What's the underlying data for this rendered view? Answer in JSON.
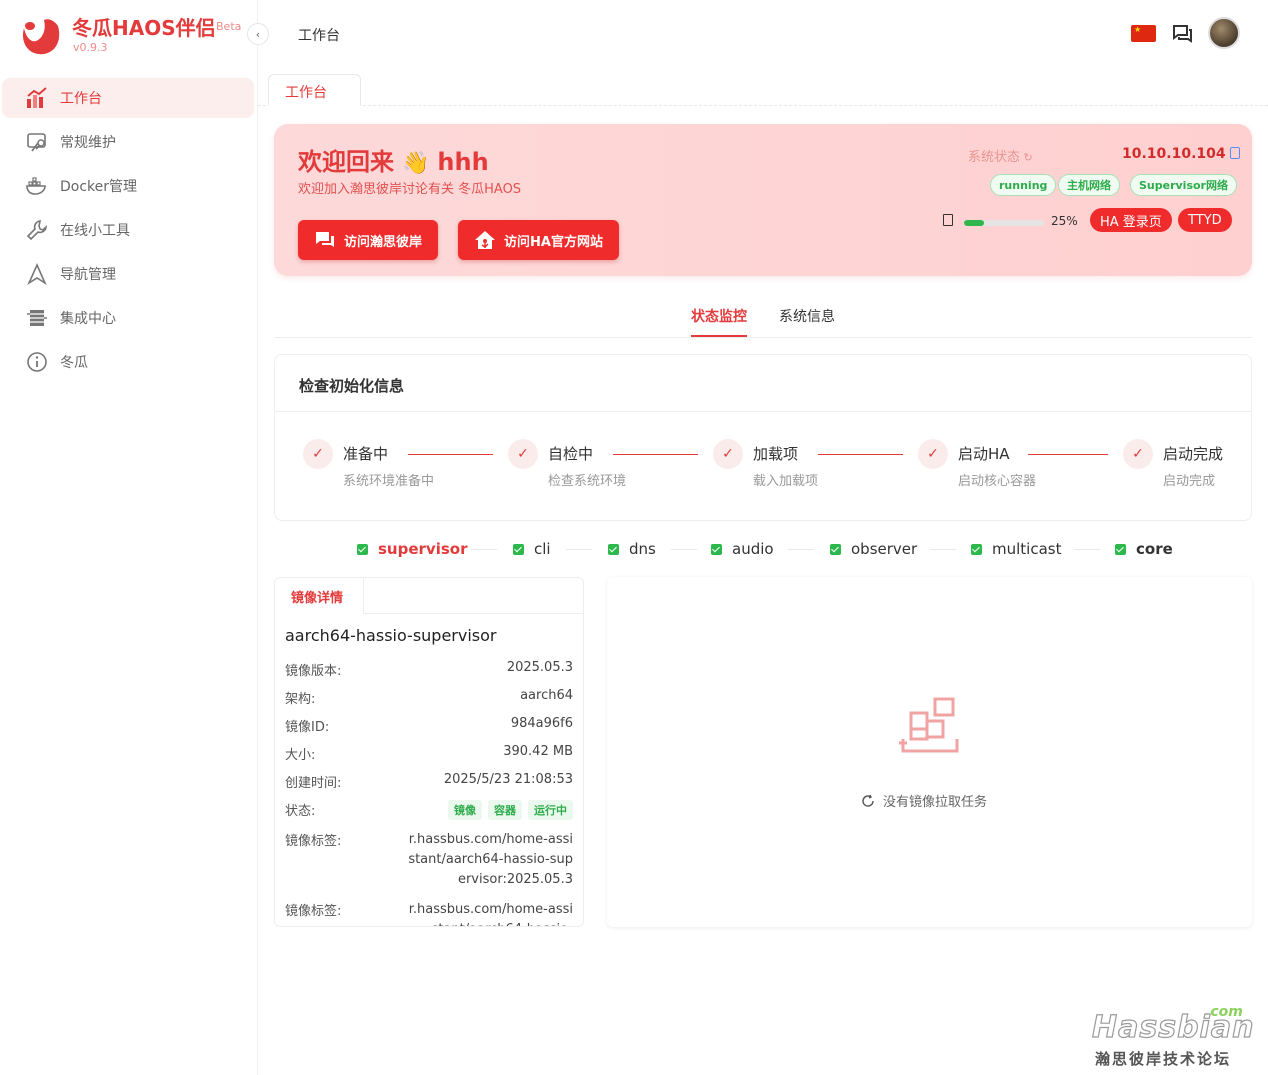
{
  "brand": {
    "title": "冬瓜HAOS伴侣",
    "beta": "Beta",
    "version": "v0.9.3"
  },
  "sidebar": {
    "items": [
      {
        "label": "工作台",
        "icon": "dashboard-icon",
        "active": true
      },
      {
        "label": "常规维护",
        "icon": "maintenance-icon"
      },
      {
        "label": "Docker管理",
        "icon": "docker-icon"
      },
      {
        "label": "在线小工具",
        "icon": "wrench-icon"
      },
      {
        "label": "导航管理",
        "icon": "navigation-icon"
      },
      {
        "label": "集成中心",
        "icon": "integration-icon"
      },
      {
        "label": "冬瓜",
        "icon": "info-icon"
      }
    ]
  },
  "header": {
    "breadcrumb": "工作台"
  },
  "tabs": {
    "page_tab": "工作台"
  },
  "welcome": {
    "title": "欢迎回来",
    "user": "hhh",
    "subtitle": "欢迎加入瀚思彼岸讨论有关 冬瓜HAOS",
    "btn_forum": "访问瀚思彼岸",
    "btn_ha": "访问HA官方网站",
    "system_status_label": "系统状态",
    "ip": "10.10.10.104",
    "pills": [
      "running",
      "主机网络",
      "Supervisor网络"
    ],
    "disk_percent_text": "25%",
    "disk_fraction": 0.25,
    "btn_ha_login": "HA 登录页",
    "btn_ttyd": "TTYD"
  },
  "segments": {
    "monitor": "状态监控",
    "sysinfo": "系统信息"
  },
  "init": {
    "title": "检查初始化信息",
    "steps": [
      {
        "title": "准备中",
        "desc": "系统环境准备中"
      },
      {
        "title": "自检中",
        "desc": "检查系统环境"
      },
      {
        "title": "加载项",
        "desc": "载入加载项"
      },
      {
        "title": "启动HA",
        "desc": "启动核心容器"
      },
      {
        "title": "启动完成",
        "desc": "启动完成"
      }
    ]
  },
  "components": [
    "supervisor",
    "cli",
    "dns",
    "audio",
    "observer",
    "multicast",
    "core"
  ],
  "detail": {
    "tab": "镜像详情",
    "name": "aarch64-hassio-supervisor",
    "rows": [
      {
        "k": "镜像版本:",
        "v": "2025.05.3"
      },
      {
        "k": "架构:",
        "v": "aarch64"
      },
      {
        "k": "镜像ID:",
        "v": "984a96f6"
      },
      {
        "k": "大小:",
        "v": "390.42 MB"
      },
      {
        "k": "创建时间:",
        "v": "2025/5/23 21:08:53"
      }
    ],
    "status_label": "状态:",
    "status_tags": [
      "镜像",
      "容器",
      "运行中"
    ],
    "tag_label": "镜像标签:",
    "tag_value": "r.hassbus.com/home-assistant/aarch64-hassio-supervisor:2025.05.3",
    "tag_label2": "镜像标签:",
    "tag_value2": "r.hassbus.com/home-assistant/aarch64-hassio-"
  },
  "empty": {
    "text": "没有镜像拉取任务"
  },
  "watermark": {
    "com": ".com",
    "main": "Hassbian",
    "sub": "瀚思彼岸技术论坛"
  },
  "colors": {
    "accent": "#e33b3b",
    "success": "#2db84d",
    "welcome_bg": "#fdd9d9"
  }
}
